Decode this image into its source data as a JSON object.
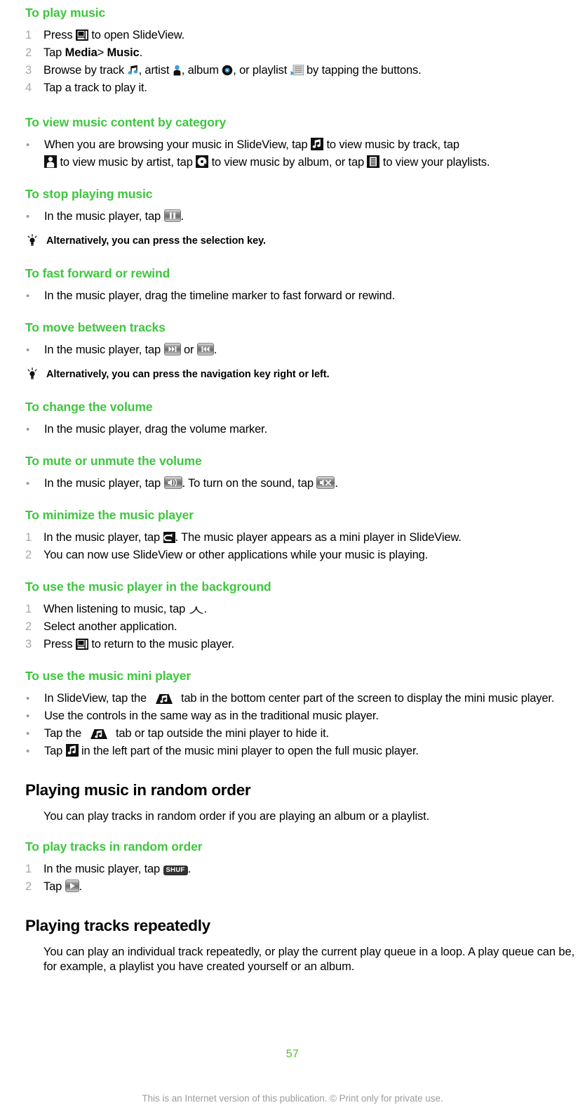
{
  "document": {
    "page_number": "57",
    "footer_note": "This is an Internet version of this publication. © Print only for private use."
  },
  "sections": [
    {
      "id": "play-music",
      "heading": "To play music",
      "steps": [
        {
          "num": "1",
          "before": "Press ",
          "icon": "slideview-key-icon",
          "after": " to open SlideView."
        },
        {
          "num": "2",
          "text_parts": [
            "Tap ",
            "Media",
            " > ",
            "Music",
            "."
          ]
        },
        {
          "num": "3",
          "text": "Browse by track , artist , album , or playlist  by tapping the buttons."
        },
        {
          "num": "4",
          "text": "Tap a track to play it."
        }
      ],
      "labels": {
        "step1_a": "Press",
        "step1_b": "to open SlideView.",
        "step2_a": "Tap",
        "step2_media": "Media",
        "step2_sep": ">",
        "step2_music": "Music",
        "step2_end": ".",
        "step3_a": "Browse by track",
        "step3_b": ", artist",
        "step3_c": ", album",
        "step3_d": ", or playlist",
        "step3_e": "by tapping the buttons.",
        "step4": "Tap a track to play it."
      }
    },
    {
      "id": "view-by-category",
      "heading": "To view music content by category",
      "bullet": {
        "a": "When you are browsing your music in SlideView, tap",
        "b": "to view music by track, tap",
        "c": "to view music by artist, tap",
        "d": "to view music by album, or tap",
        "e": "to view your playlists."
      }
    },
    {
      "id": "stop-playing",
      "heading": "To stop playing music",
      "bullet": {
        "a": "In the music player, tap",
        "b": "."
      },
      "tip": "Alternatively, you can press the selection key."
    },
    {
      "id": "fast-forward",
      "heading": "To fast forward or rewind",
      "bullet": {
        "a": "In the music player, drag the timeline marker to fast forward or rewind."
      }
    },
    {
      "id": "move-tracks",
      "heading": "To move between tracks",
      "bullet": {
        "a": "In the music player, tap",
        "b": "or",
        "c": "."
      },
      "tip": "Alternatively, you can press the navigation key right or left."
    },
    {
      "id": "change-volume",
      "heading": "To change the volume",
      "bullet": {
        "a": "In the music player, drag the volume marker."
      }
    },
    {
      "id": "mute-volume",
      "heading": "To mute or unmute the volume",
      "bullet": {
        "a": "In the music player, tap",
        "b": ". To turn on the sound, tap",
        "c": "."
      }
    },
    {
      "id": "minimize-player",
      "heading": "To minimize the music player",
      "steps": {
        "s1a": "In the music player, tap",
        "s1b": ". The music player appears as a mini player in SlideView.",
        "s2": "You can now use SlideView or other applications while your music is playing."
      }
    },
    {
      "id": "background-player",
      "heading": "To use the music player in the background",
      "steps": {
        "s1a": "When listening to music, tap",
        "s1b": ".",
        "s2": "Select another application.",
        "s3a": "Press",
        "s3b": "to return to the music player."
      }
    },
    {
      "id": "mini-player",
      "heading": "To use the music mini player",
      "bullets": {
        "b1a": "In SlideView, tap the",
        "b1b": "tab in the bottom center part of the screen to display the mini music player.",
        "b2": "Use the controls in the same way as in the traditional music player.",
        "b3a": "Tap the",
        "b3b": "tab or tap outside the mini player to hide it.",
        "b4a": "Tap",
        "b4b": "in the left part of the music mini player to open the full music player."
      }
    },
    {
      "id": "random-order",
      "heading": "Playing music in random order",
      "intro": "You can play tracks in random order if you are playing an album or a playlist.",
      "sub_heading": "To play tracks in random order",
      "steps": {
        "s1a": "In the music player, tap",
        "s1b": ".",
        "s2a": "Tap",
        "s2b": "."
      },
      "shuffle_label": "SHUF"
    },
    {
      "id": "repeat-tracks",
      "heading": "Playing tracks repeatedly",
      "intro": "You can play an individual track repeatedly, or play the current play queue in a loop. A play queue can be, for example, a playlist you have created yourself or an album."
    }
  ],
  "colors": {
    "heading_green": "#3ec63e",
    "page_number_green": "#52c234",
    "marker_gray": "#a8a8a8",
    "footer_gray": "#9c9c9c",
    "icon_blue": "#3f9fd8",
    "icon_black": "#111111"
  }
}
